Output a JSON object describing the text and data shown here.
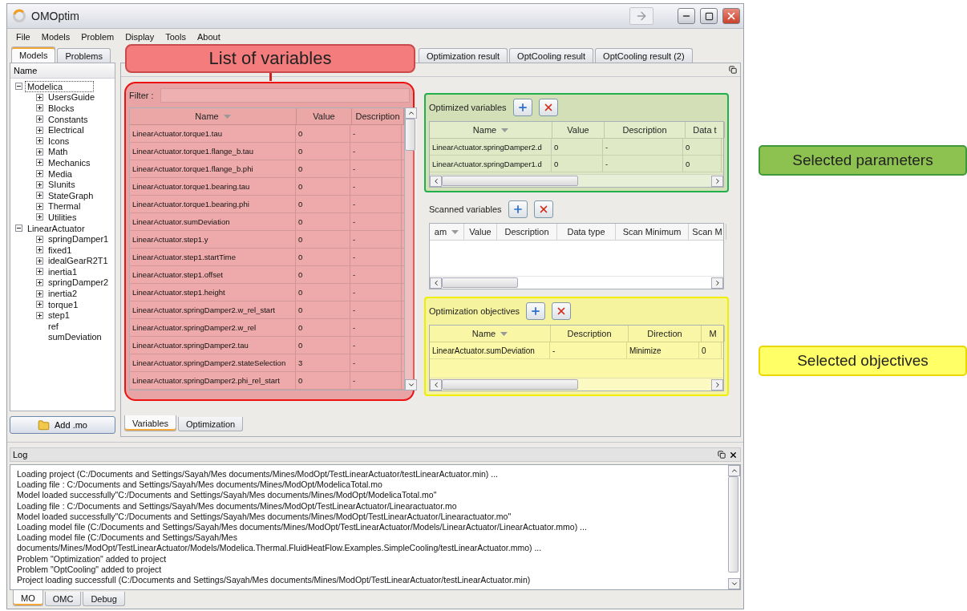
{
  "window": {
    "title": "OMOptim"
  },
  "menu": [
    "File",
    "Models",
    "Problem",
    "Display",
    "Tools",
    "About"
  ],
  "left_tabs": [
    {
      "label": "Models",
      "selected": true
    },
    {
      "label": "Problems",
      "selected": false
    }
  ],
  "tree": {
    "header": "Name",
    "items": [
      {
        "label": "Modelica",
        "expanded": true,
        "selected": true,
        "children": [
          {
            "label": "UsersGuide",
            "expanded": false,
            "selected": false
          },
          {
            "label": "Blocks",
            "expanded": false,
            "selected": false
          },
          {
            "label": "Constants",
            "expanded": false,
            "selected": false
          },
          {
            "label": "Electrical",
            "expanded": false,
            "selected": false
          },
          {
            "label": "Icons",
            "expanded": false,
            "selected": false
          },
          {
            "label": "Math",
            "expanded": false,
            "selected": false
          },
          {
            "label": "Mechanics",
            "expanded": false,
            "selected": false
          },
          {
            "label": "Media",
            "expanded": false,
            "selected": false
          },
          {
            "label": "SIunits",
            "expanded": false,
            "selected": false
          },
          {
            "label": "StateGraph",
            "expanded": false,
            "selected": false
          },
          {
            "label": "Thermal",
            "expanded": false,
            "selected": false
          },
          {
            "label": "Utilities",
            "expanded": false,
            "selected": false
          }
        ]
      },
      {
        "label": "LinearActuator",
        "expanded": true,
        "selected": false,
        "children": [
          {
            "label": "springDamper1",
            "expanded": false,
            "selected": false
          },
          {
            "label": "fixed1",
            "expanded": false,
            "selected": false
          },
          {
            "label": "idealGearR2T1",
            "expanded": false,
            "selected": false
          },
          {
            "label": "inertia1",
            "expanded": false,
            "selected": false
          },
          {
            "label": "springDamper2",
            "expanded": false,
            "selected": false
          },
          {
            "label": "inertia2",
            "expanded": false,
            "selected": false
          },
          {
            "label": "torque1",
            "expanded": false,
            "selected": false
          },
          {
            "label": "step1",
            "expanded": false,
            "selected": false
          },
          {
            "label": "ref",
            "selected": false
          },
          {
            "label": "sumDeviation",
            "selected": false
          }
        ]
      }
    ]
  },
  "add_button": "Add .mo",
  "result_tabs": [
    {
      "label": "Optimization result",
      "selected": false
    },
    {
      "label": "OptCooling result",
      "selected": false
    },
    {
      "label": "OptCooling result (2)",
      "selected": false
    }
  ],
  "callouts": [
    {
      "kind": "variables",
      "label": "List of variables",
      "color": "#f47c7c"
    },
    {
      "kind": "parameters",
      "label": "Selected parameters",
      "color": "#8dc150"
    },
    {
      "kind": "objectives",
      "label": "Selected objectives",
      "color": "#ffff66"
    }
  ],
  "variables": {
    "filter_label": "Filter :",
    "columns": [
      "Name",
      "Value",
      "Description"
    ],
    "rows": [
      [
        "LinearActuator.torque1.tau",
        "0",
        "-"
      ],
      [
        "LinearActuator.torque1.flange_b.tau",
        "0",
        "-"
      ],
      [
        "LinearActuator.torque1.flange_b.phi",
        "0",
        "-"
      ],
      [
        "LinearActuator.torque1.bearing.tau",
        "0",
        "-"
      ],
      [
        "LinearActuator.torque1.bearing.phi",
        "0",
        "-"
      ],
      [
        "LinearActuator.sumDeviation",
        "0",
        "-"
      ],
      [
        "LinearActuator.step1.y",
        "0",
        "-"
      ],
      [
        "LinearActuator.step1.startTime",
        "0",
        "-"
      ],
      [
        "LinearActuator.step1.offset",
        "0",
        "-"
      ],
      [
        "LinearActuator.step1.height",
        "0",
        "-"
      ],
      [
        "LinearActuator.springDamper2.w_rel_start",
        "0",
        "-"
      ],
      [
        "LinearActuator.springDamper2.w_rel",
        "0",
        "-"
      ],
      [
        "LinearActuator.springDamper2.tau",
        "0",
        "-"
      ],
      [
        "LinearActuator.springDamper2.stateSelection",
        "3",
        "-"
      ],
      [
        "LinearActuator.springDamper2.phi_rel_start",
        "0",
        "-"
      ]
    ]
  },
  "optimized": {
    "title": "Optimized variables",
    "columns": [
      "Name",
      "Value",
      "Description",
      "Data t"
    ],
    "rows": [
      [
        "LinearActuator.springDamper2.d",
        "0",
        "-",
        "0"
      ],
      [
        "LinearActuator.springDamper1.d",
        "0",
        "-",
        "0"
      ]
    ]
  },
  "scanned": {
    "title": "Scanned variables",
    "columns": [
      "am",
      "Value",
      "Description",
      "Data type",
      "Scan Minimum",
      "Scan M"
    ]
  },
  "objectives": {
    "title": "Optimization objectives",
    "columns": [
      "Name",
      "Description",
      "Direction",
      "M"
    ],
    "rows": [
      [
        "LinearActuator.sumDeviation",
        "-",
        "Minimize",
        "0"
      ]
    ]
  },
  "bottom_tabs": [
    {
      "label": "Variables",
      "selected": true
    },
    {
      "label": "Optimization",
      "selected": false
    }
  ],
  "log": {
    "title": "Log",
    "lines": [
      "Loading project (C:/Documents and Settings/Sayah/Mes documents/Mines/ModOpt/TestLinearActuator/testLinearActuator.min) ...",
      "Loading file : C:/Documents and Settings/Sayah/Mes documents/Mines/ModOpt/ModelicaTotal.mo",
      "Model loaded successfully\"C:/Documents and Settings/Sayah/Mes documents/Mines/ModOpt/ModelicaTotal.mo\"",
      "Loading file : C:/Documents and Settings/Sayah/Mes documents/Mines/ModOpt/TestLinearActuator/Linearactuator.mo",
      "Model loaded successfully\"C:/Documents and Settings/Sayah/Mes documents/Mines/ModOpt/TestLinearActuator/Linearactuator.mo\"",
      "Loading model file (C:/Documents and Settings/Sayah/Mes documents/Mines/ModOpt/TestLinearActuator/Models/LinearActuator/LinearActuator.mmo) ...",
      "Loading model file (C:/Documents and Settings/Sayah/Mes",
      "documents/Mines/ModOpt/TestLinearActuator/Models/Modelica.Thermal.FluidHeatFlow.Examples.SimpleCooling/testLinearActuator.mmo) ...",
      "Problem \"Optimization\" added to project",
      "Problem \"OptCooling\" added to project",
      "Project loading successfull (C:/Documents and Settings/Sayah/Mes documents/Mines/ModOpt/TestLinearActuator/testLinearActuator.min)"
    ],
    "tabs": [
      {
        "label": "MO",
        "selected": true
      },
      {
        "label": "OMC",
        "selected": false
      },
      {
        "label": "Debug",
        "selected": false
      }
    ]
  }
}
